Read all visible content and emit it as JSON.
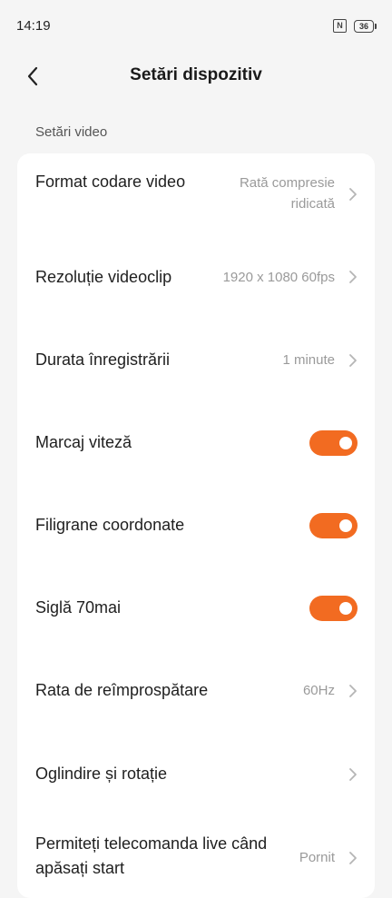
{
  "status_bar": {
    "time": "14:19",
    "nfc_label": "N",
    "battery_level": "36"
  },
  "header": {
    "title": "Setări dispozitiv",
    "back_icon": "chevron-left-icon"
  },
  "section": {
    "title": "Setări video"
  },
  "settings": [
    {
      "label": "Format codare video",
      "value": "Rată compresie ridicată",
      "control": "chevron"
    },
    {
      "label": "Rezoluție videoclip",
      "value": "1920 x 1080 60fps",
      "control": "chevron"
    },
    {
      "label": "Durata înregistrării",
      "value": "1 minute",
      "control": "chevron"
    },
    {
      "label": "Marcaj viteză",
      "control": "toggle",
      "on": true
    },
    {
      "label": "Filigrane coordonate",
      "control": "toggle",
      "on": true
    },
    {
      "label": "Siglă 70mai",
      "control": "toggle",
      "on": true
    },
    {
      "label": "Rata de reîmprospătare",
      "value": "60Hz",
      "control": "chevron"
    },
    {
      "label": "Oglindire și rotație",
      "value": "",
      "control": "chevron"
    },
    {
      "label": "Permiteți telecomanda live când apăsați start",
      "value": "Pornit",
      "control": "chevron"
    }
  ],
  "colors": {
    "accent": "#f26b21",
    "background": "#f5f5f5",
    "card": "#ffffff",
    "secondary_text": "#9a9a9a"
  }
}
